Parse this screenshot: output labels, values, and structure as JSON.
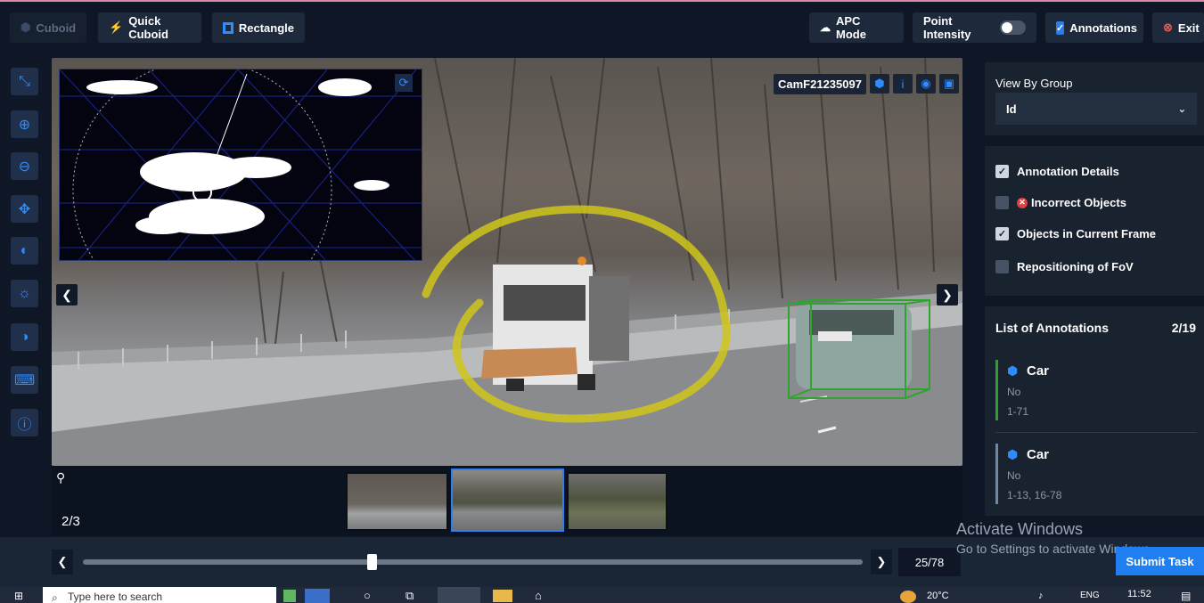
{
  "toolbar": {
    "cuboid": "Cuboid",
    "quick_cuboid": "Quick Cuboid",
    "rectangle": "Rectangle",
    "apc_mode": "APC Mode",
    "point_intensity": "Point Intensity",
    "annotations": "Annotations",
    "exit": "Exit",
    "accent": "#2f8cff"
  },
  "camera": {
    "name": "CamF21235097"
  },
  "viewer": {
    "frame_index": "2/3",
    "frame_counter": "25/78",
    "slider_position": 0.37
  },
  "right_panel": {
    "view_by_group_label": "View By Group",
    "view_by_group_value": "Id",
    "options": [
      {
        "label": "Annotation Details",
        "checked": true
      },
      {
        "label": "Incorrect Objects",
        "checked": false
      },
      {
        "label": "Objects in Current Frame",
        "checked": true
      },
      {
        "label": "Repositioning of FoV",
        "checked": false
      }
    ],
    "list_title": "List of Annotations",
    "list_count": "2/19",
    "annotations": [
      {
        "label": "Car",
        "status": "No",
        "frames": "1-71",
        "accent": "#2e9e2e"
      },
      {
        "label": "Car",
        "status": "No",
        "frames": "1-13, 16-78",
        "accent": "#6f87a6"
      }
    ]
  },
  "submit_label": "Submit Task",
  "watermark": {
    "title": "Activate Windows",
    "subtitle": "Go to Settings to activate Windows."
  },
  "taskbar": {
    "search_placeholder": "Type here to search",
    "weather": "20°C",
    "language": "ENG",
    "time": "11:52"
  }
}
